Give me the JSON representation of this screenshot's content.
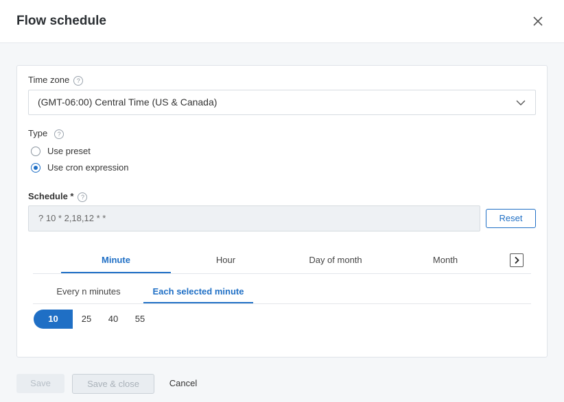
{
  "dialog": {
    "title": "Flow schedule"
  },
  "timezone": {
    "label": "Time zone",
    "help": "?",
    "value": "(GMT-06:00) Central Time (US & Canada)"
  },
  "type": {
    "label": "Type",
    "help": "?",
    "options": [
      {
        "label": "Use preset",
        "selected": false
      },
      {
        "label": "Use cron expression",
        "selected": true
      }
    ]
  },
  "schedule": {
    "label": "Schedule *",
    "help": "?",
    "value": "? 10 * 2,18,12 * *",
    "reset_label": "Reset"
  },
  "unit_tabs": [
    {
      "label": "Minute",
      "active": true
    },
    {
      "label": "Hour",
      "active": false
    },
    {
      "label": "Day of month",
      "active": false
    },
    {
      "label": "Month",
      "active": false
    }
  ],
  "mode_tabs": [
    {
      "label": "Every n minutes",
      "active": false
    },
    {
      "label": "Each selected minute",
      "active": true
    }
  ],
  "minutes": [
    {
      "label": "10",
      "selected": true
    },
    {
      "label": "25",
      "selected": false
    },
    {
      "label": "40",
      "selected": false
    },
    {
      "label": "55",
      "selected": false
    }
  ],
  "footer": {
    "save": "Save",
    "save_close": "Save & close",
    "cancel": "Cancel"
  },
  "colors": {
    "accent": "#1f6fc5",
    "disabled_bg": "#e9edf1"
  }
}
